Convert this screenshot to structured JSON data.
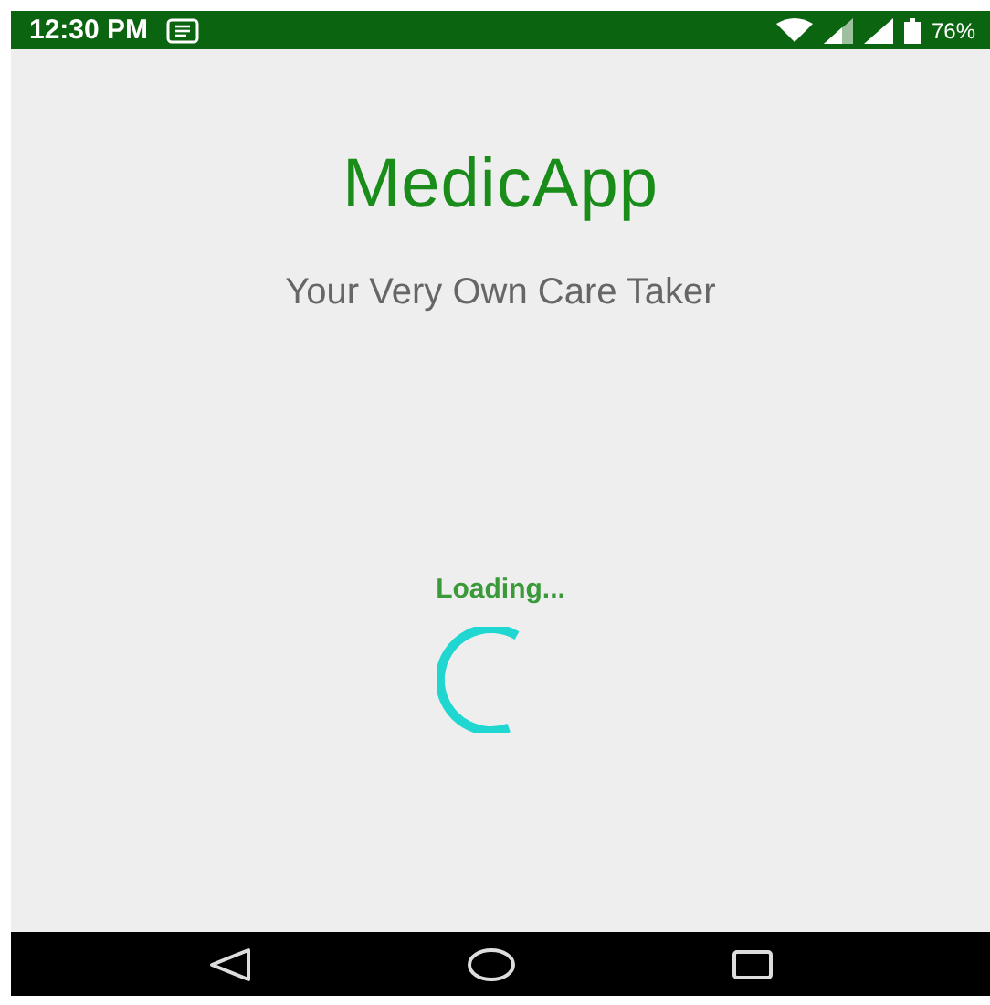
{
  "status_bar": {
    "time": "12:30 PM",
    "battery": "76%"
  },
  "app": {
    "title": "MedicApp",
    "tagline": "Your Very Own Care Taker",
    "loading_text": "Loading..."
  }
}
